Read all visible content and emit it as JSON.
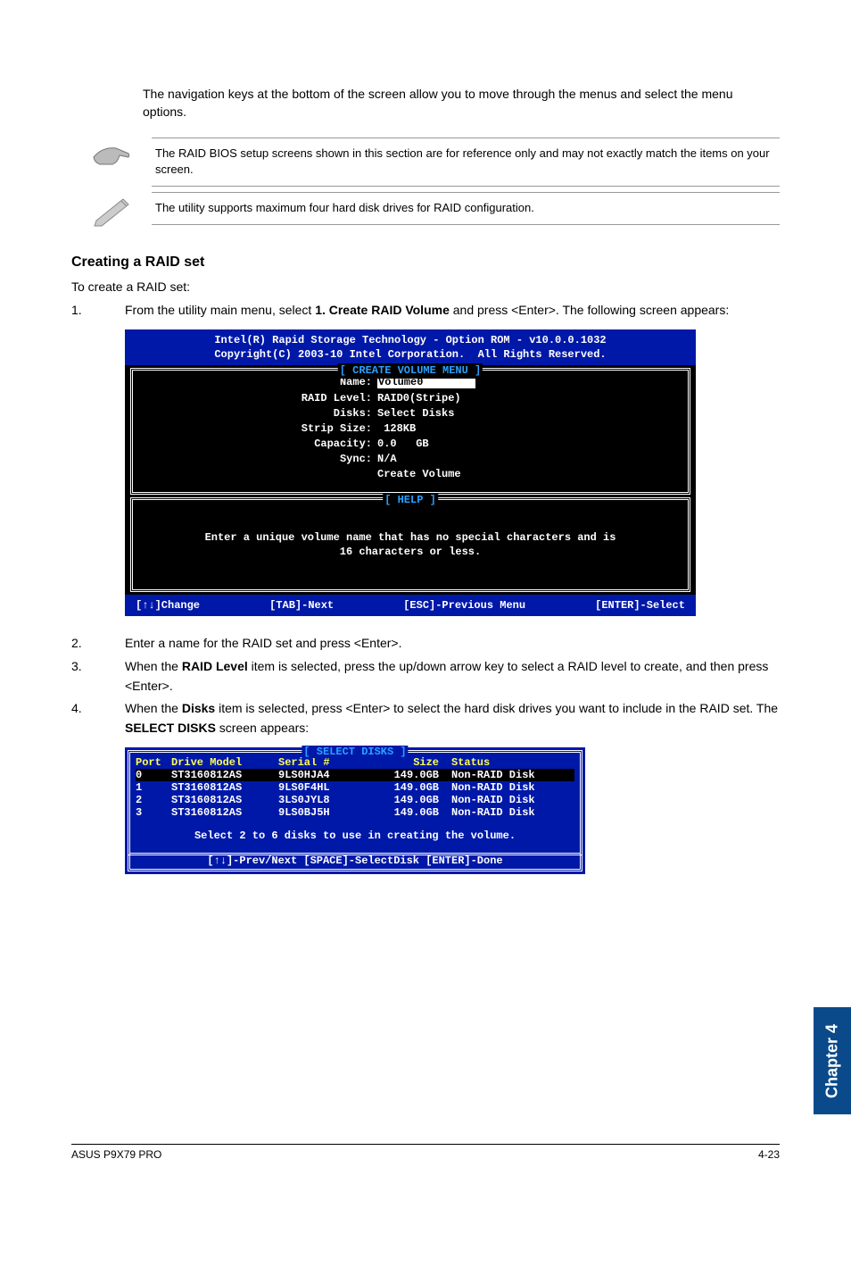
{
  "intro": "The navigation keys at the bottom of the screen allow you to move through the menus and select the menu options.",
  "notes": {
    "note1": "The RAID BIOS setup screens shown in this section are for reference only and may not exactly match the items on your screen.",
    "note2": "The utility supports maximum four hard disk drives for RAID configuration."
  },
  "section_heading": "Creating a RAID set",
  "section_sub": "To create a RAID set:",
  "steps": {
    "s1_num": "1.",
    "s1_a": "From the utility main menu, select ",
    "s1_b": "1. Create RAID Volume",
    "s1_c": " and press <Enter>. The following screen appears:",
    "s2_num": "2.",
    "s2": "Enter a name for the RAID set and press <Enter>.",
    "s3_num": "3.",
    "s3_a": "When the ",
    "s3_b": "RAID Level",
    "s3_c": " item is selected, press the up/down arrow key to select a RAID level to create, and then press <Enter>.",
    "s4_num": "4.",
    "s4_a": "When the ",
    "s4_b": "Disks",
    "s4_c": " item is selected, press <Enter> to select the hard disk drives you want to include in the RAID set. The ",
    "s4_d": "SELECT DISKS",
    "s4_e": " screen appears:"
  },
  "bios": {
    "header1": "Intel(R) Rapid Storage Technology - Option ROM - v10.0.0.1032",
    "header2": "Copyright(C) 2003-10 Intel Corporation.  All Rights Reserved.",
    "frame1_title": "[ CREATE VOLUME MENU ]",
    "fields": {
      "name_l": "Name:",
      "name_v": "Volume0        ",
      "level_l": "RAID Level:",
      "level_v": "RAID0(Stripe)",
      "disks_l": "Disks:",
      "disks_v": "Select Disks",
      "strip_l": "Strip Size:",
      "strip_v": " 128KB",
      "cap_l": "Capacity:",
      "cap_v": "0.0   GB",
      "sync_l": "Sync:",
      "sync_v": "N/A",
      "create": "Create Volume"
    },
    "help_title": "[ HELP ]",
    "help_text": "Enter a unique volume name that has no special characters and is\n16 characters or less.",
    "nav": {
      "a": "[↑↓]Change",
      "b": "[TAB]-Next",
      "c": "[ESC]-Previous Menu",
      "d": "[ENTER]-Select"
    }
  },
  "disks": {
    "title": "[ SELECT DISKS ]",
    "head": {
      "c1": "Port",
      "c2": "Drive Model",
      "c3": "Serial #",
      "c4": "Size",
      "c5": "Status"
    },
    "rows": [
      {
        "c1": "0",
        "c2": "ST3160812AS",
        "c3": "9LS0HJA4",
        "c4": "149.0GB",
        "c5": "Non-RAID Disk"
      },
      {
        "c1": "1",
        "c2": "ST3160812AS",
        "c3": "9LS0F4HL",
        "c4": "149.0GB",
        "c5": "Non-RAID Disk"
      },
      {
        "c1": "2",
        "c2": "ST3160812AS",
        "c3": "3LS0JYL8",
        "c4": "149.0GB",
        "c5": "Non-RAID Disk"
      },
      {
        "c1": "3",
        "c2": "ST3160812AS",
        "c3": "9LS0BJ5H",
        "c4": "149.0GB",
        "c5": "Non-RAID Disk"
      }
    ],
    "msg": "Select 2 to 6 disks to use in creating the volume.",
    "nav": "[↑↓]-Prev/Next [SPACE]-SelectDisk [ENTER]-Done"
  },
  "side_tab": "Chapter 4",
  "footer": {
    "left": "ASUS P9X79 PRO",
    "right": "4-23"
  }
}
